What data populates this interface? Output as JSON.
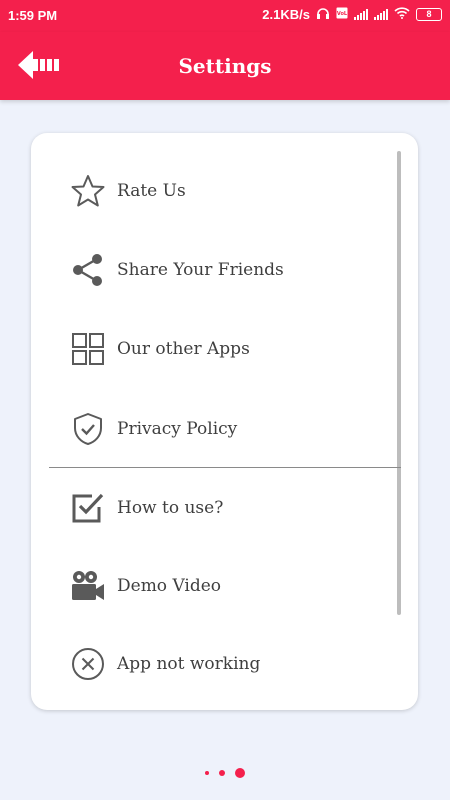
{
  "status": {
    "time": "1:59 PM",
    "net_speed": "2.1KB/s",
    "battery": "8"
  },
  "toolbar": {
    "title": "Settings"
  },
  "menu": [
    {
      "label": "Rate Us",
      "icon": "star-icon"
    },
    {
      "label": "Share Your Friends",
      "icon": "share-icon"
    },
    {
      "label": "Our other Apps",
      "icon": "grid-icon"
    },
    {
      "label": "Privacy Policy",
      "icon": "shield-check-icon"
    },
    {
      "label": "How to use?",
      "icon": "checkbox-icon"
    },
    {
      "label": "Demo Video",
      "icon": "video-camera-icon"
    },
    {
      "label": "App not working",
      "icon": "close-circle-icon"
    }
  ],
  "pager": {
    "count": 3,
    "active_index": 2
  },
  "colors": {
    "accent": "#f4204c",
    "background": "#eef2fb",
    "text": "#3f3f3f",
    "icon": "#5a5a5a"
  }
}
